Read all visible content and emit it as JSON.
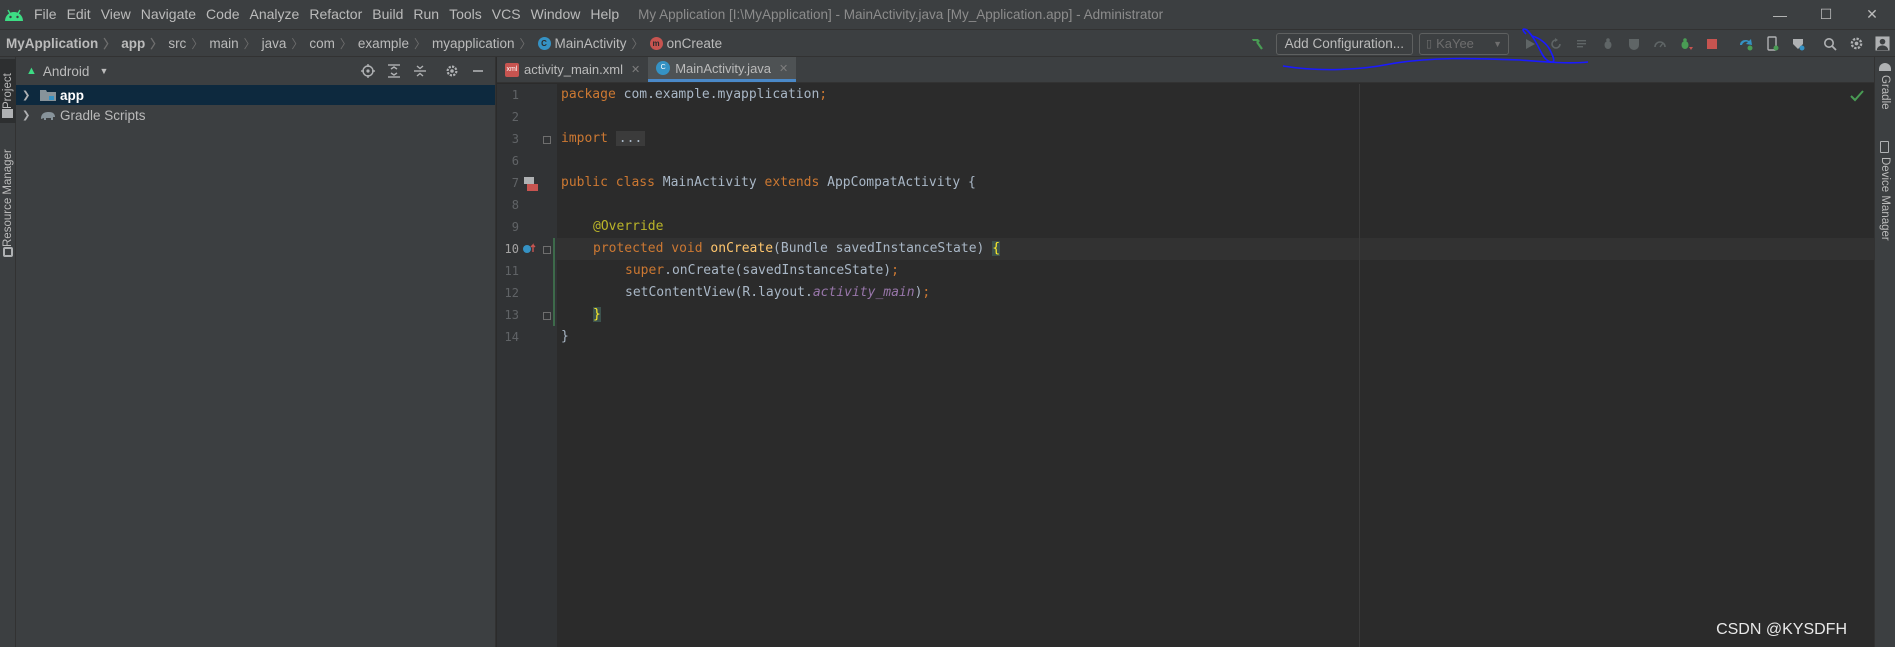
{
  "menu": [
    "File",
    "Edit",
    "View",
    "Navigate",
    "Code",
    "Analyze",
    "Refactor",
    "Build",
    "Run",
    "Tools",
    "VCS",
    "Window",
    "Help"
  ],
  "window_title": "My Application [I:\\MyApplication] - MainActivity.java [My_Application.app] - Administrator",
  "window_controls": {
    "minimize": "—",
    "maximize": "☐",
    "close": "✕"
  },
  "breadcrumbs": [
    {
      "label": "MyApplication",
      "bold": true
    },
    {
      "label": "app",
      "bold": true
    },
    {
      "label": "src"
    },
    {
      "label": "main"
    },
    {
      "label": "java"
    },
    {
      "label": "com"
    },
    {
      "label": "example"
    },
    {
      "label": "myapplication"
    },
    {
      "label": "MainActivity",
      "icon": "C",
      "icon_color": "#3592c4"
    },
    {
      "label": "onCreate",
      "icon": "m",
      "icon_color": "#c75450"
    }
  ],
  "toolbar": {
    "add_config_label": "Add Configuration...",
    "device_label": "KaYee"
  },
  "left_stripe": {
    "project_tab": "Project",
    "resource_tab": "Resource Manager"
  },
  "project_panel": {
    "view_select": "Android",
    "tree": [
      {
        "label": "app",
        "selected": true,
        "bold": true
      },
      {
        "label": "Gradle Scripts",
        "selected": false
      }
    ]
  },
  "tabs": [
    {
      "label": "activity_main.xml",
      "active": false,
      "icon": "xml"
    },
    {
      "label": "MainActivity.java",
      "active": true,
      "icon": "C"
    }
  ],
  "line_numbers": [
    "1",
    "2",
    "3",
    "6",
    "7",
    "8",
    "9",
    "10",
    "11",
    "12",
    "13",
    "14"
  ],
  "code": {
    "l1_kw": "package",
    "l1_rest": " com.example.myapplication",
    "l1_semi": ";",
    "l3_kw": "import",
    "l3_fold": "...",
    "l7_kw1": "public",
    "l7_kw2": "class",
    "l7_name": " MainActivity ",
    "l7_kw3": "extends",
    "l7_rest": " AppCompatActivity {",
    "l9_ann": "@Override",
    "l10_kw1": "protected",
    "l10_kw2": "void",
    "l10_fn": "onCreate",
    "l10_rest": "(Bundle savedInstanceState) ",
    "l10_brace": "{",
    "l11_kw": "super",
    "l11_rest": ".onCreate(savedInstanceState)",
    "l11_semi": ";",
    "l12_rest": "setContentView(R.layout.",
    "l12_field": "activity_main",
    "l12_end": ")",
    "l12_semi": ";",
    "l13_brace": "}",
    "l14_brace": "}"
  },
  "right_stripe": {
    "gradle_tab": "Gradle",
    "device_manager_tab": "Device Manager"
  },
  "watermark": "CSDN @KYSDFH",
  "colors": {
    "accent": "#4a88c7",
    "annotation_ink": "#1a1aff",
    "android_green": "#3ddc84"
  }
}
